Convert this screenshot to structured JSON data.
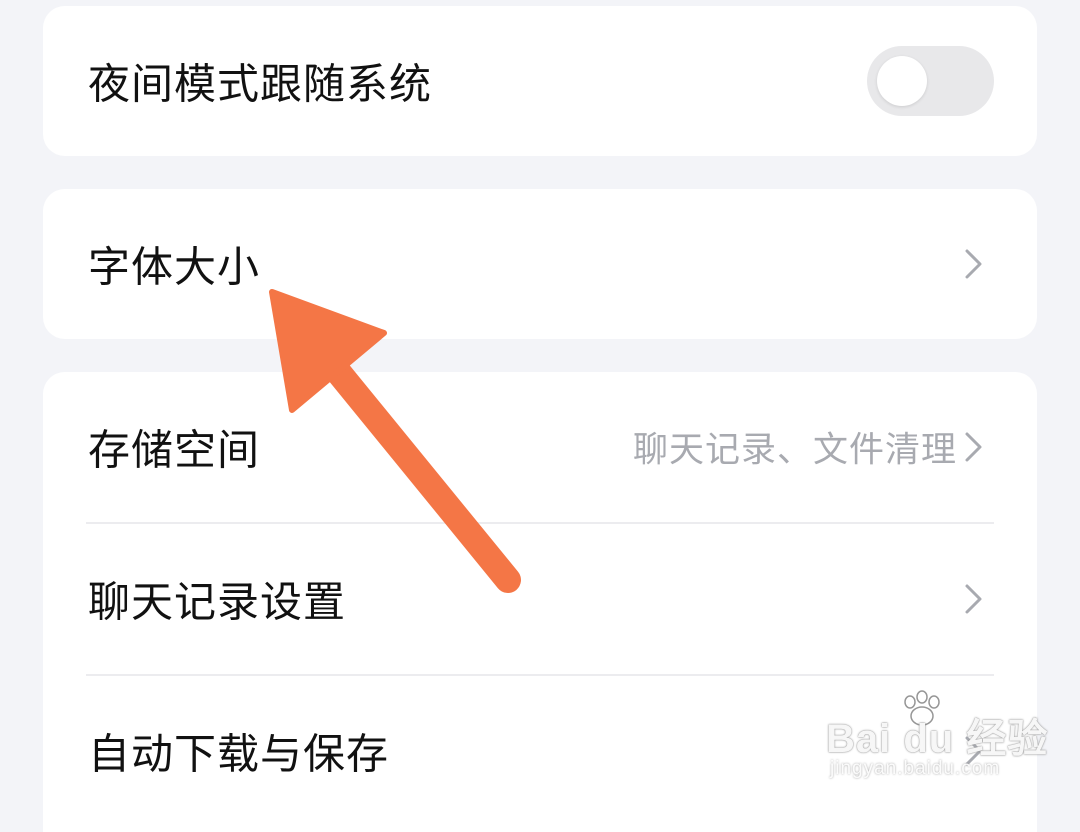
{
  "settings": {
    "night_mode": {
      "label": "夜间模式跟随系统",
      "enabled": false
    },
    "font_size": {
      "label": "字体大小"
    },
    "storage": {
      "label": "存储空间",
      "value": "聊天记录、文件清理"
    },
    "chat_history": {
      "label": "聊天记录设置"
    },
    "auto_download": {
      "label": "自动下载与保存"
    }
  },
  "annotation": {
    "arrow_color": "#f47646",
    "pointing_to": "字体大小"
  },
  "watermark": {
    "brand": "Bai du 经验",
    "url": "jingyan.baidu.com"
  },
  "icons": {
    "chevron": "chevron-right-icon"
  },
  "colors": {
    "background": "#f3f4f8",
    "card": "#ffffff",
    "text": "#111111",
    "secondary_text": "#a8aab0",
    "toggle_off": "#e8e8ea"
  }
}
